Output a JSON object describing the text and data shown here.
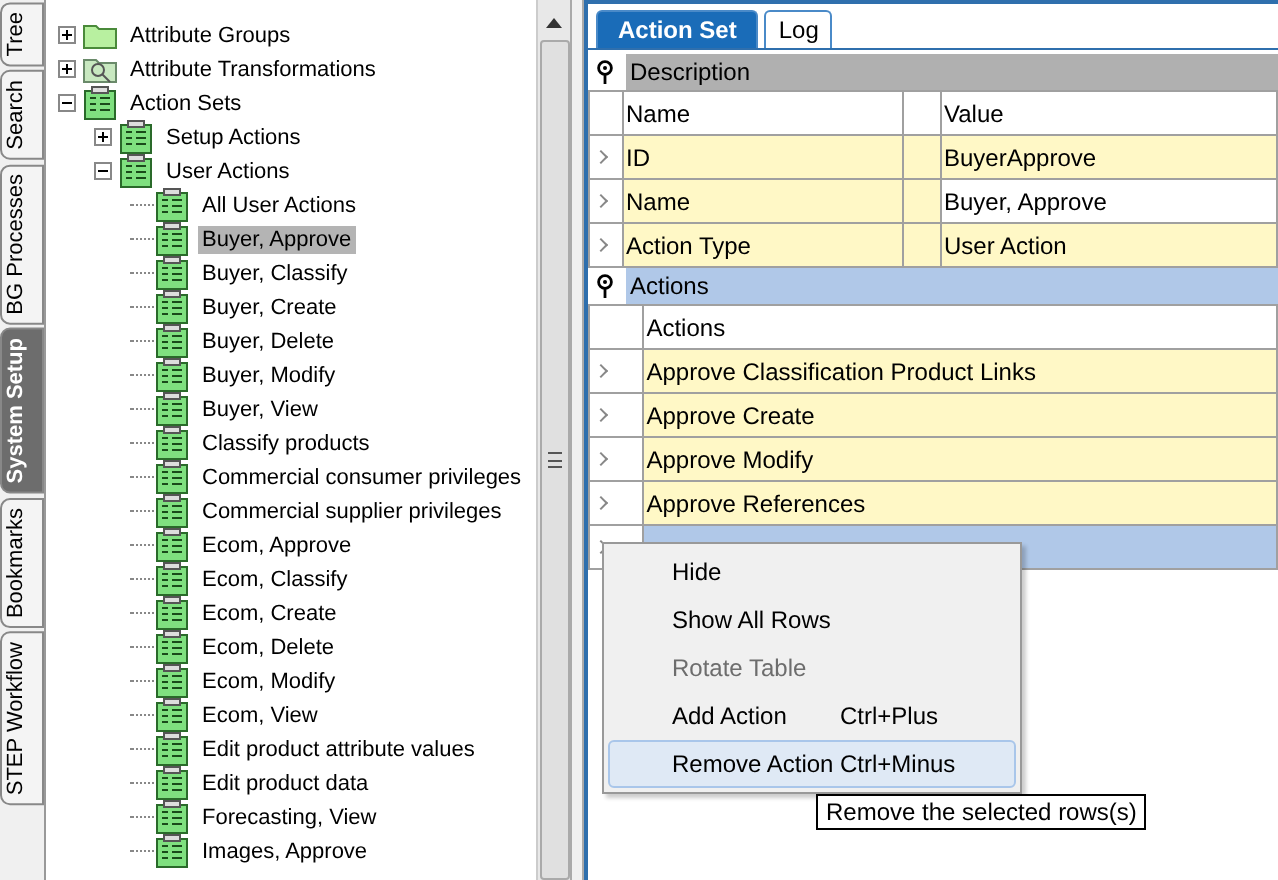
{
  "side_tabs": [
    {
      "label": "Tree",
      "selected": false
    },
    {
      "label": "Search",
      "selected": false
    },
    {
      "label": "BG Processes",
      "selected": false
    },
    {
      "label": "System Setup",
      "selected": true
    },
    {
      "label": "Bookmarks",
      "selected": false
    },
    {
      "label": "STEP Workflow",
      "selected": false
    }
  ],
  "tree": [
    {
      "label": "Attribute Groups",
      "kind": "folder",
      "expanded": false,
      "selected": false
    },
    {
      "label": "Attribute Transformations",
      "kind": "transform",
      "expanded": false,
      "selected": false
    },
    {
      "label": "Action Sets",
      "kind": "action-set",
      "expanded": true,
      "selected": false,
      "children": [
        {
          "label": "Setup Actions",
          "kind": "action-set",
          "expanded": false,
          "selected": false
        },
        {
          "label": "User Actions",
          "kind": "action-set",
          "expanded": true,
          "selected": false,
          "children": [
            {
              "label": "All User Actions",
              "kind": "action-set",
              "selected": false
            },
            {
              "label": "Buyer, Approve",
              "kind": "action-set",
              "selected": true
            },
            {
              "label": "Buyer, Classify",
              "kind": "action-set",
              "selected": false
            },
            {
              "label": "Buyer, Create",
              "kind": "action-set",
              "selected": false
            },
            {
              "label": "Buyer, Delete",
              "kind": "action-set",
              "selected": false
            },
            {
              "label": "Buyer, Modify",
              "kind": "action-set",
              "selected": false
            },
            {
              "label": "Buyer, View",
              "kind": "action-set",
              "selected": false
            },
            {
              "label": "Classify products",
              "kind": "action-set",
              "selected": false
            },
            {
              "label": "Commercial consumer privileges",
              "kind": "action-set",
              "selected": false
            },
            {
              "label": "Commercial supplier privileges",
              "kind": "action-set",
              "selected": false
            },
            {
              "label": "Ecom, Approve",
              "kind": "action-set",
              "selected": false
            },
            {
              "label": "Ecom, Classify",
              "kind": "action-set",
              "selected": false
            },
            {
              "label": "Ecom, Create",
              "kind": "action-set",
              "selected": false
            },
            {
              "label": "Ecom, Delete",
              "kind": "action-set",
              "selected": false
            },
            {
              "label": "Ecom, Modify",
              "kind": "action-set",
              "selected": false
            },
            {
              "label": "Ecom, View",
              "kind": "action-set",
              "selected": false
            },
            {
              "label": "Edit product attribute values",
              "kind": "action-set",
              "selected": false
            },
            {
              "label": "Edit product data",
              "kind": "action-set",
              "selected": false
            },
            {
              "label": "Forecasting, View",
              "kind": "action-set",
              "selected": false
            },
            {
              "label": "Images, Approve",
              "kind": "action-set",
              "selected": false
            }
          ]
        }
      ]
    }
  ],
  "tabs": [
    {
      "label": "Action Set",
      "selected": true
    },
    {
      "label": "Log",
      "selected": false
    }
  ],
  "description": {
    "title": "Description",
    "columns": [
      "Name",
      "Value"
    ],
    "rows": [
      {
        "name": "ID",
        "value": "BuyerApprove",
        "highlighted": true
      },
      {
        "name": "Name",
        "value": "Buyer, Approve",
        "highlighted": false
      },
      {
        "name": "Action Type",
        "value": "User Action",
        "highlighted": true
      }
    ]
  },
  "actions": {
    "title": "Actions",
    "column": "Actions",
    "rows": [
      {
        "label": "Approve Classification Product Links",
        "selected": false
      },
      {
        "label": "Approve Create",
        "selected": false
      },
      {
        "label": "Approve Modify",
        "selected": false
      },
      {
        "label": "Approve References",
        "selected": false
      },
      {
        "selected": true
      }
    ]
  },
  "context_menu": [
    {
      "label": "Hide",
      "disabled": false,
      "selected": false
    },
    {
      "label": "Show All Rows",
      "disabled": false,
      "selected": false
    },
    {
      "label": "Rotate Table",
      "disabled": true,
      "selected": false
    },
    {
      "label": "Add Action",
      "shortcut": "Ctrl+Plus",
      "disabled": false,
      "selected": false
    },
    {
      "label": "Remove Action",
      "shortcut": "Ctrl+Minus",
      "disabled": false,
      "selected": true
    }
  ],
  "tooltip": "Remove the selected rows(s)"
}
